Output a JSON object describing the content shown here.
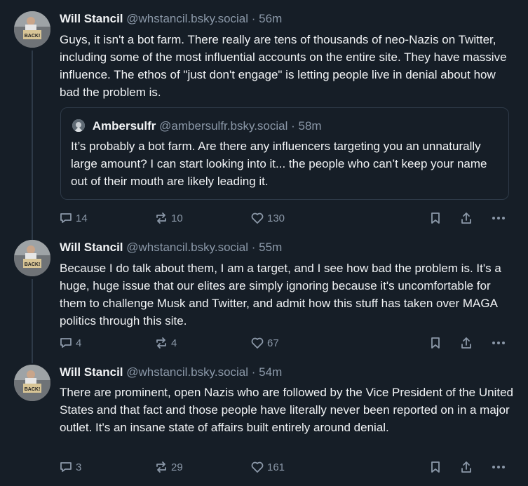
{
  "posts": [
    {
      "author": "Will Stancil",
      "handle": "@whstancil.bsky.social",
      "time": "· 56m",
      "text": "Guys, it isn't a bot farm. There really are tens of thousands of neo-Nazis on Twitter, including some of the most influential accounts on the entire site. They have massive influence. The ethos of \"just don't engage\" is letting people live in denial about how bad the problem is.",
      "quote": {
        "author": "Ambersulfr",
        "handle": "@ambersulfr.bsky.social",
        "time": "· 58m",
        "text": "It’s probably a bot farm. Are there any influencers targeting you an unnaturally large amount? I can start looking into it... the people who can’t keep your name out of their mouth are likely leading it."
      },
      "replies": "14",
      "reposts": "10",
      "likes": "130",
      "avatar_sign": "BACK!"
    },
    {
      "author": "Will Stancil",
      "handle": "@whstancil.bsky.social",
      "time": "· 55m",
      "text": "Because I do talk about them, I am a target, and I see how bad the problem is. It's a huge, huge issue that our elites are simply ignoring because it's uncomfortable for them to challenge Musk and Twitter, and admit how this stuff has taken over MAGA politics through this site.",
      "replies": "4",
      "reposts": "4",
      "likes": "67",
      "avatar_sign": "BACK!"
    },
    {
      "author": "Will Stancil",
      "handle": "@whstancil.bsky.social",
      "time": "· 54m",
      "text": "There are prominent, open Nazis who are followed by the Vice President of the United States and that fact and those people have literally never been reported on in a major outlet. It's an insane state of affairs built entirely around denial.",
      "replies": "3",
      "reposts": "29",
      "likes": "161",
      "avatar_sign": "BACK!"
    }
  ],
  "icons": {
    "reply": "reply-icon",
    "repost": "repost-icon",
    "like": "heart-icon",
    "bookmark": "bookmark-icon",
    "share": "share-icon",
    "more": "more-icon"
  },
  "colors": {
    "background": "#161e27",
    "text": "#f1f3f5",
    "muted": "#8b98a8",
    "border": "#2e3a48"
  }
}
